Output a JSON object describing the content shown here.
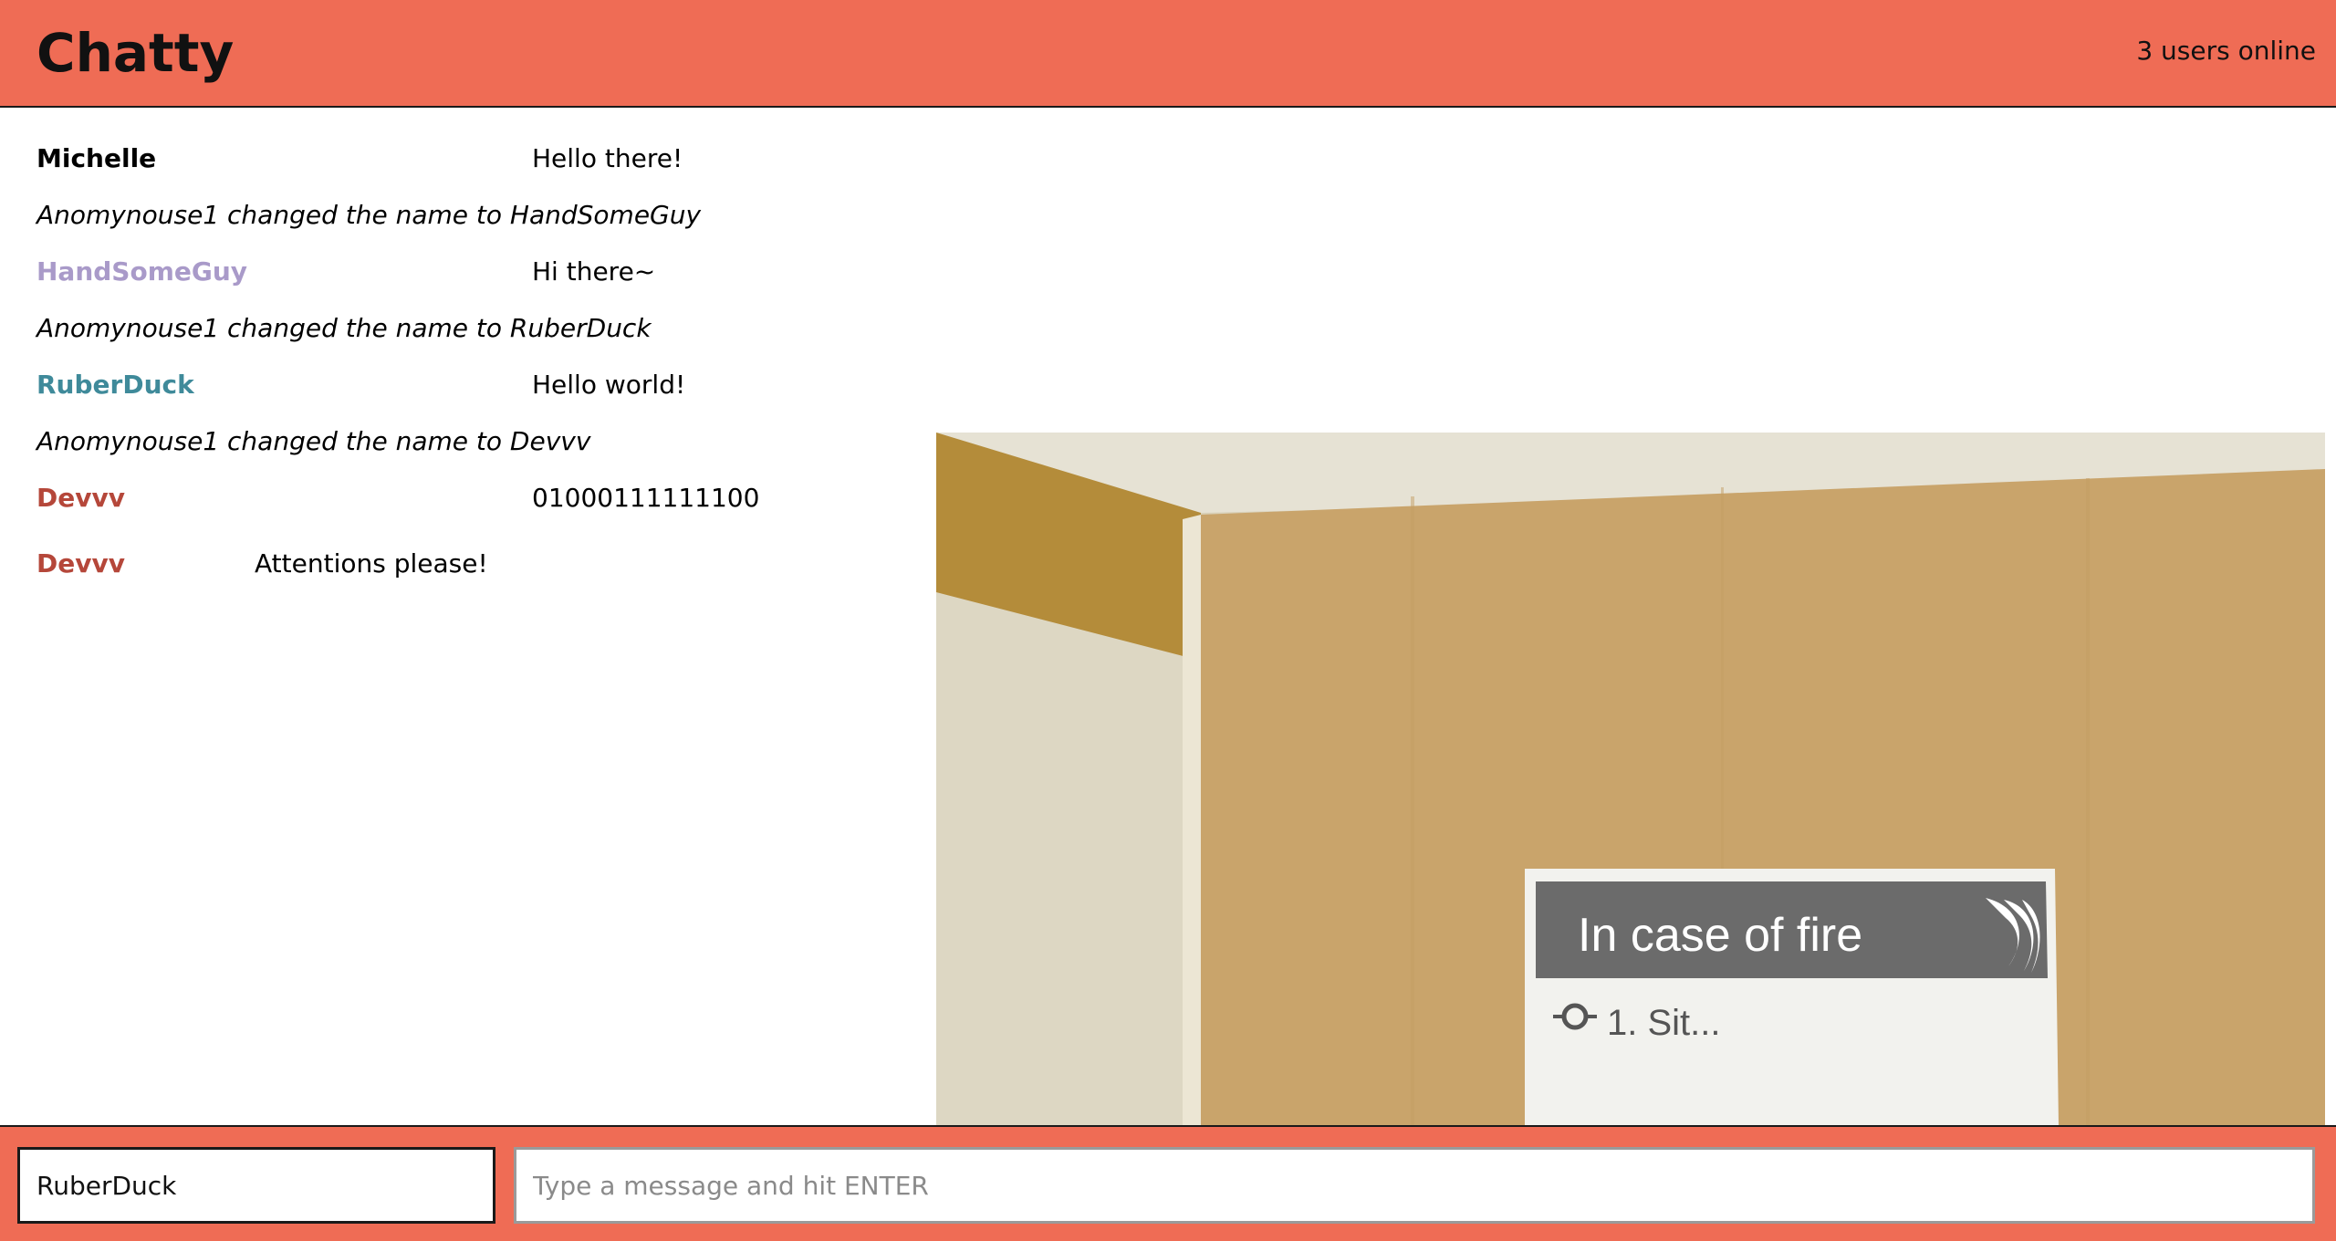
{
  "header": {
    "title": "Chatty",
    "online_count": "3 users online"
  },
  "messages": [
    {
      "type": "message",
      "user": "Michelle",
      "content": "Hello there!",
      "color": "#000000"
    },
    {
      "type": "notification",
      "content": "Anomynouse1 changed the name to HandSomeGuy"
    },
    {
      "type": "message",
      "user": "HandSomeGuy",
      "content": "Hi there~",
      "color": "#a99ac9"
    },
    {
      "type": "notification",
      "content": "Anomynouse1 changed the name to RuberDuck"
    },
    {
      "type": "message",
      "user": "RuberDuck",
      "content": "Hello world!",
      "color": "#3f8a9a"
    },
    {
      "type": "notification",
      "content": "Anomynouse1 changed the name to Devvv"
    },
    {
      "type": "message",
      "user": "Devvv",
      "content": "01000111111100",
      "color": "#b5473a"
    },
    {
      "type": "message",
      "user": "Devvv",
      "content": "Attentions please!",
      "color": "#b5473a"
    }
  ],
  "image_message": {
    "sign_text": "In case of fire",
    "sign_partial_line": "1. Sit..."
  },
  "footer": {
    "username_value": "RuberDuck",
    "message_placeholder": "Type a message and hit ENTER"
  },
  "colors": {
    "accent": "#ef6c55"
  }
}
